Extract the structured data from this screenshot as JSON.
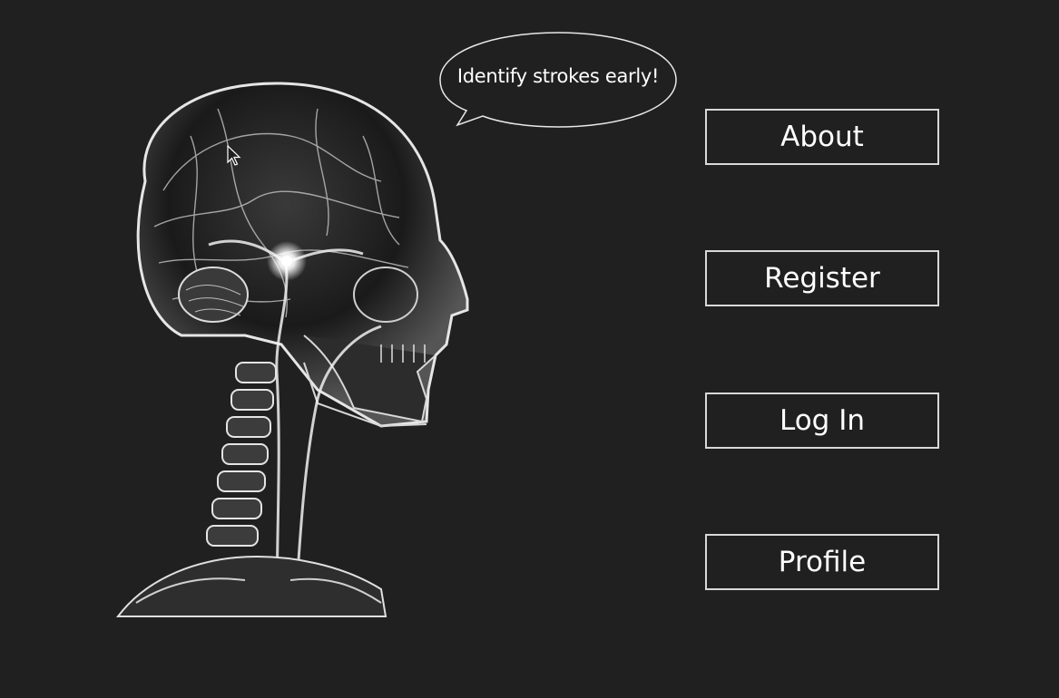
{
  "hero": {
    "illustration": "xray-head-skeleton-brain-vessels",
    "speech_bubble_text": "Identify strokes early!"
  },
  "nav": {
    "buttons": [
      {
        "label": "About"
      },
      {
        "label": "Register"
      },
      {
        "label": "Log In"
      },
      {
        "label": "Profile"
      }
    ]
  },
  "colors": {
    "background": "#202020",
    "foreground": "#ffffff",
    "border": "#d8d8d8"
  }
}
